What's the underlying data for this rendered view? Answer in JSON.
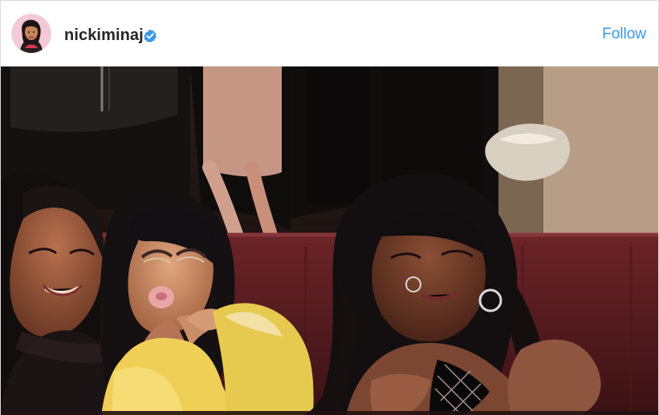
{
  "post": {
    "username": "nickiminaj",
    "verified_icon": "verified-badge-icon",
    "follow_label": "Follow",
    "avatar_icon": "profile-avatar",
    "photo_label": "post-photo"
  },
  "colors": {
    "link_blue": "#3897f0",
    "username_text": "#262626",
    "verified_blue": "#3897f0",
    "border": "#dbdbdb"
  }
}
